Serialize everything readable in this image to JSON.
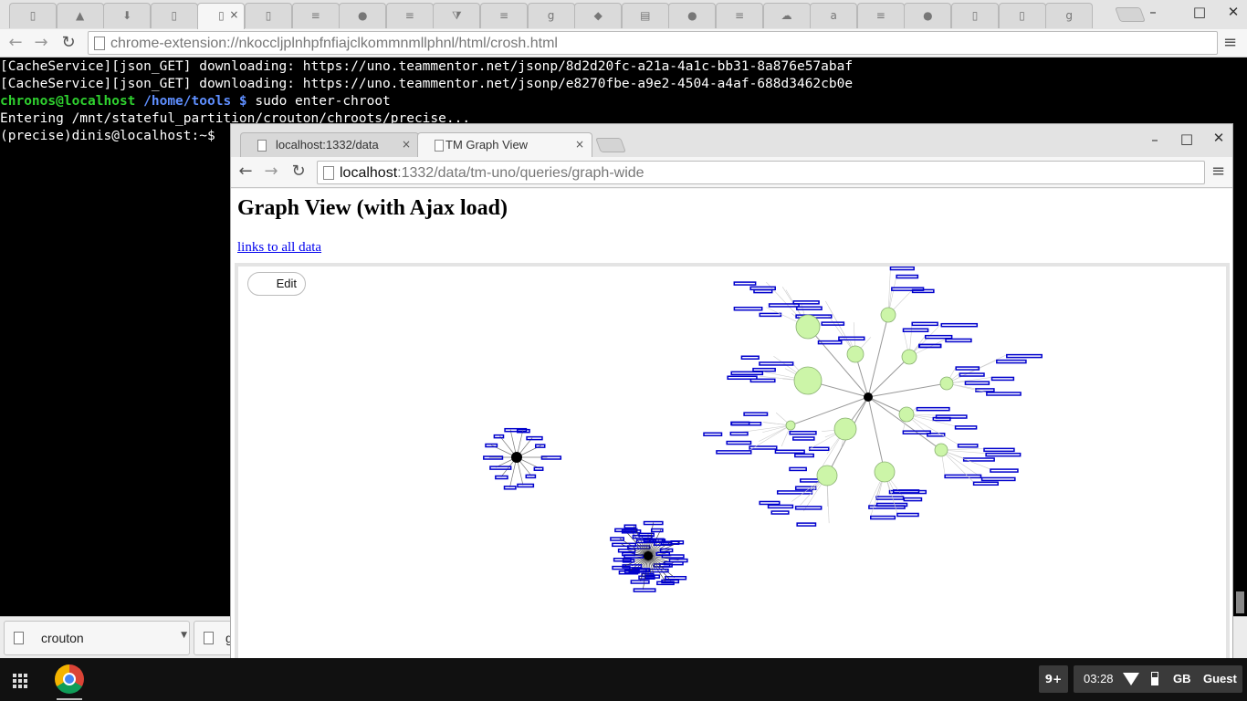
{
  "outer_browser": {
    "tabs": [
      {
        "icon": "page-icon"
      },
      {
        "icon": "arch-icon"
      },
      {
        "icon": "download-icon"
      },
      {
        "icon": "page-icon"
      },
      {
        "icon": "page-icon",
        "active": true,
        "close": "×"
      },
      {
        "icon": "page-icon"
      },
      {
        "icon": "stackoverflow-icon"
      },
      {
        "icon": "github-icon"
      },
      {
        "icon": "stackoverflow-icon"
      },
      {
        "icon": "filter-icon"
      },
      {
        "icon": "stackoverflow-icon"
      },
      {
        "icon": "google-icon"
      },
      {
        "icon": "python-icon"
      },
      {
        "icon": "book-icon"
      },
      {
        "icon": "github-icon"
      },
      {
        "icon": "stackoverflow-icon"
      },
      {
        "icon": "cloud-icon"
      },
      {
        "icon": "ask-icon"
      },
      {
        "icon": "stackoverflow-icon"
      },
      {
        "icon": "github-icon"
      },
      {
        "icon": "page-icon"
      },
      {
        "icon": "page-icon"
      },
      {
        "icon": "google-icon"
      }
    ],
    "url": "chrome-extension://nkoccljplnhpfnfiajclkommnmllphnl/html/crosh.html"
  },
  "terminal": {
    "lines": [
      "[CacheService][json_GET] downloading: https://uno.teammentor.net/jsonp/8d2d20fc-a21a-4a1c-bb31-8a876e57abaf",
      "[CacheService][json_GET] downloading: https://uno.teammentor.net/jsonp/e8270fbe-a9e2-4504-a4af-688d3462cb0e"
    ],
    "prompt_user": "chronos@localhost",
    "prompt_path": "/home/tools",
    "prompt_sym": "$",
    "command": "sudo enter-chroot",
    "entering": "Entering /mnt/stateful_partition/crouton/chroots/precise...",
    "chroot_prompt": "(precise)dinis@localhost:~$"
  },
  "downloads": [
    {
      "name": "crouton"
    },
    {
      "name": "g"
    }
  ],
  "inner_browser": {
    "tabs": [
      {
        "title": "localhost:1332/data",
        "close": "×"
      },
      {
        "title": "TM Graph View",
        "close": "×",
        "active": true
      }
    ],
    "url_host": "localhost",
    "url_rest": ":1332/data/tm-uno/queries/graph-wide",
    "page": {
      "heading": "Graph View (with Ajax load)",
      "link": "links to all data",
      "edit_label": "Edit"
    }
  },
  "graph_style": {
    "hub_color": "#000000",
    "topic_color": "#ccf5a8",
    "leaf_color": "#0000cc",
    "edge_color": "#999999"
  },
  "taskbar": {
    "notifications": "9+",
    "time": "03:28",
    "keyboard": "GB",
    "user": "Guest"
  }
}
